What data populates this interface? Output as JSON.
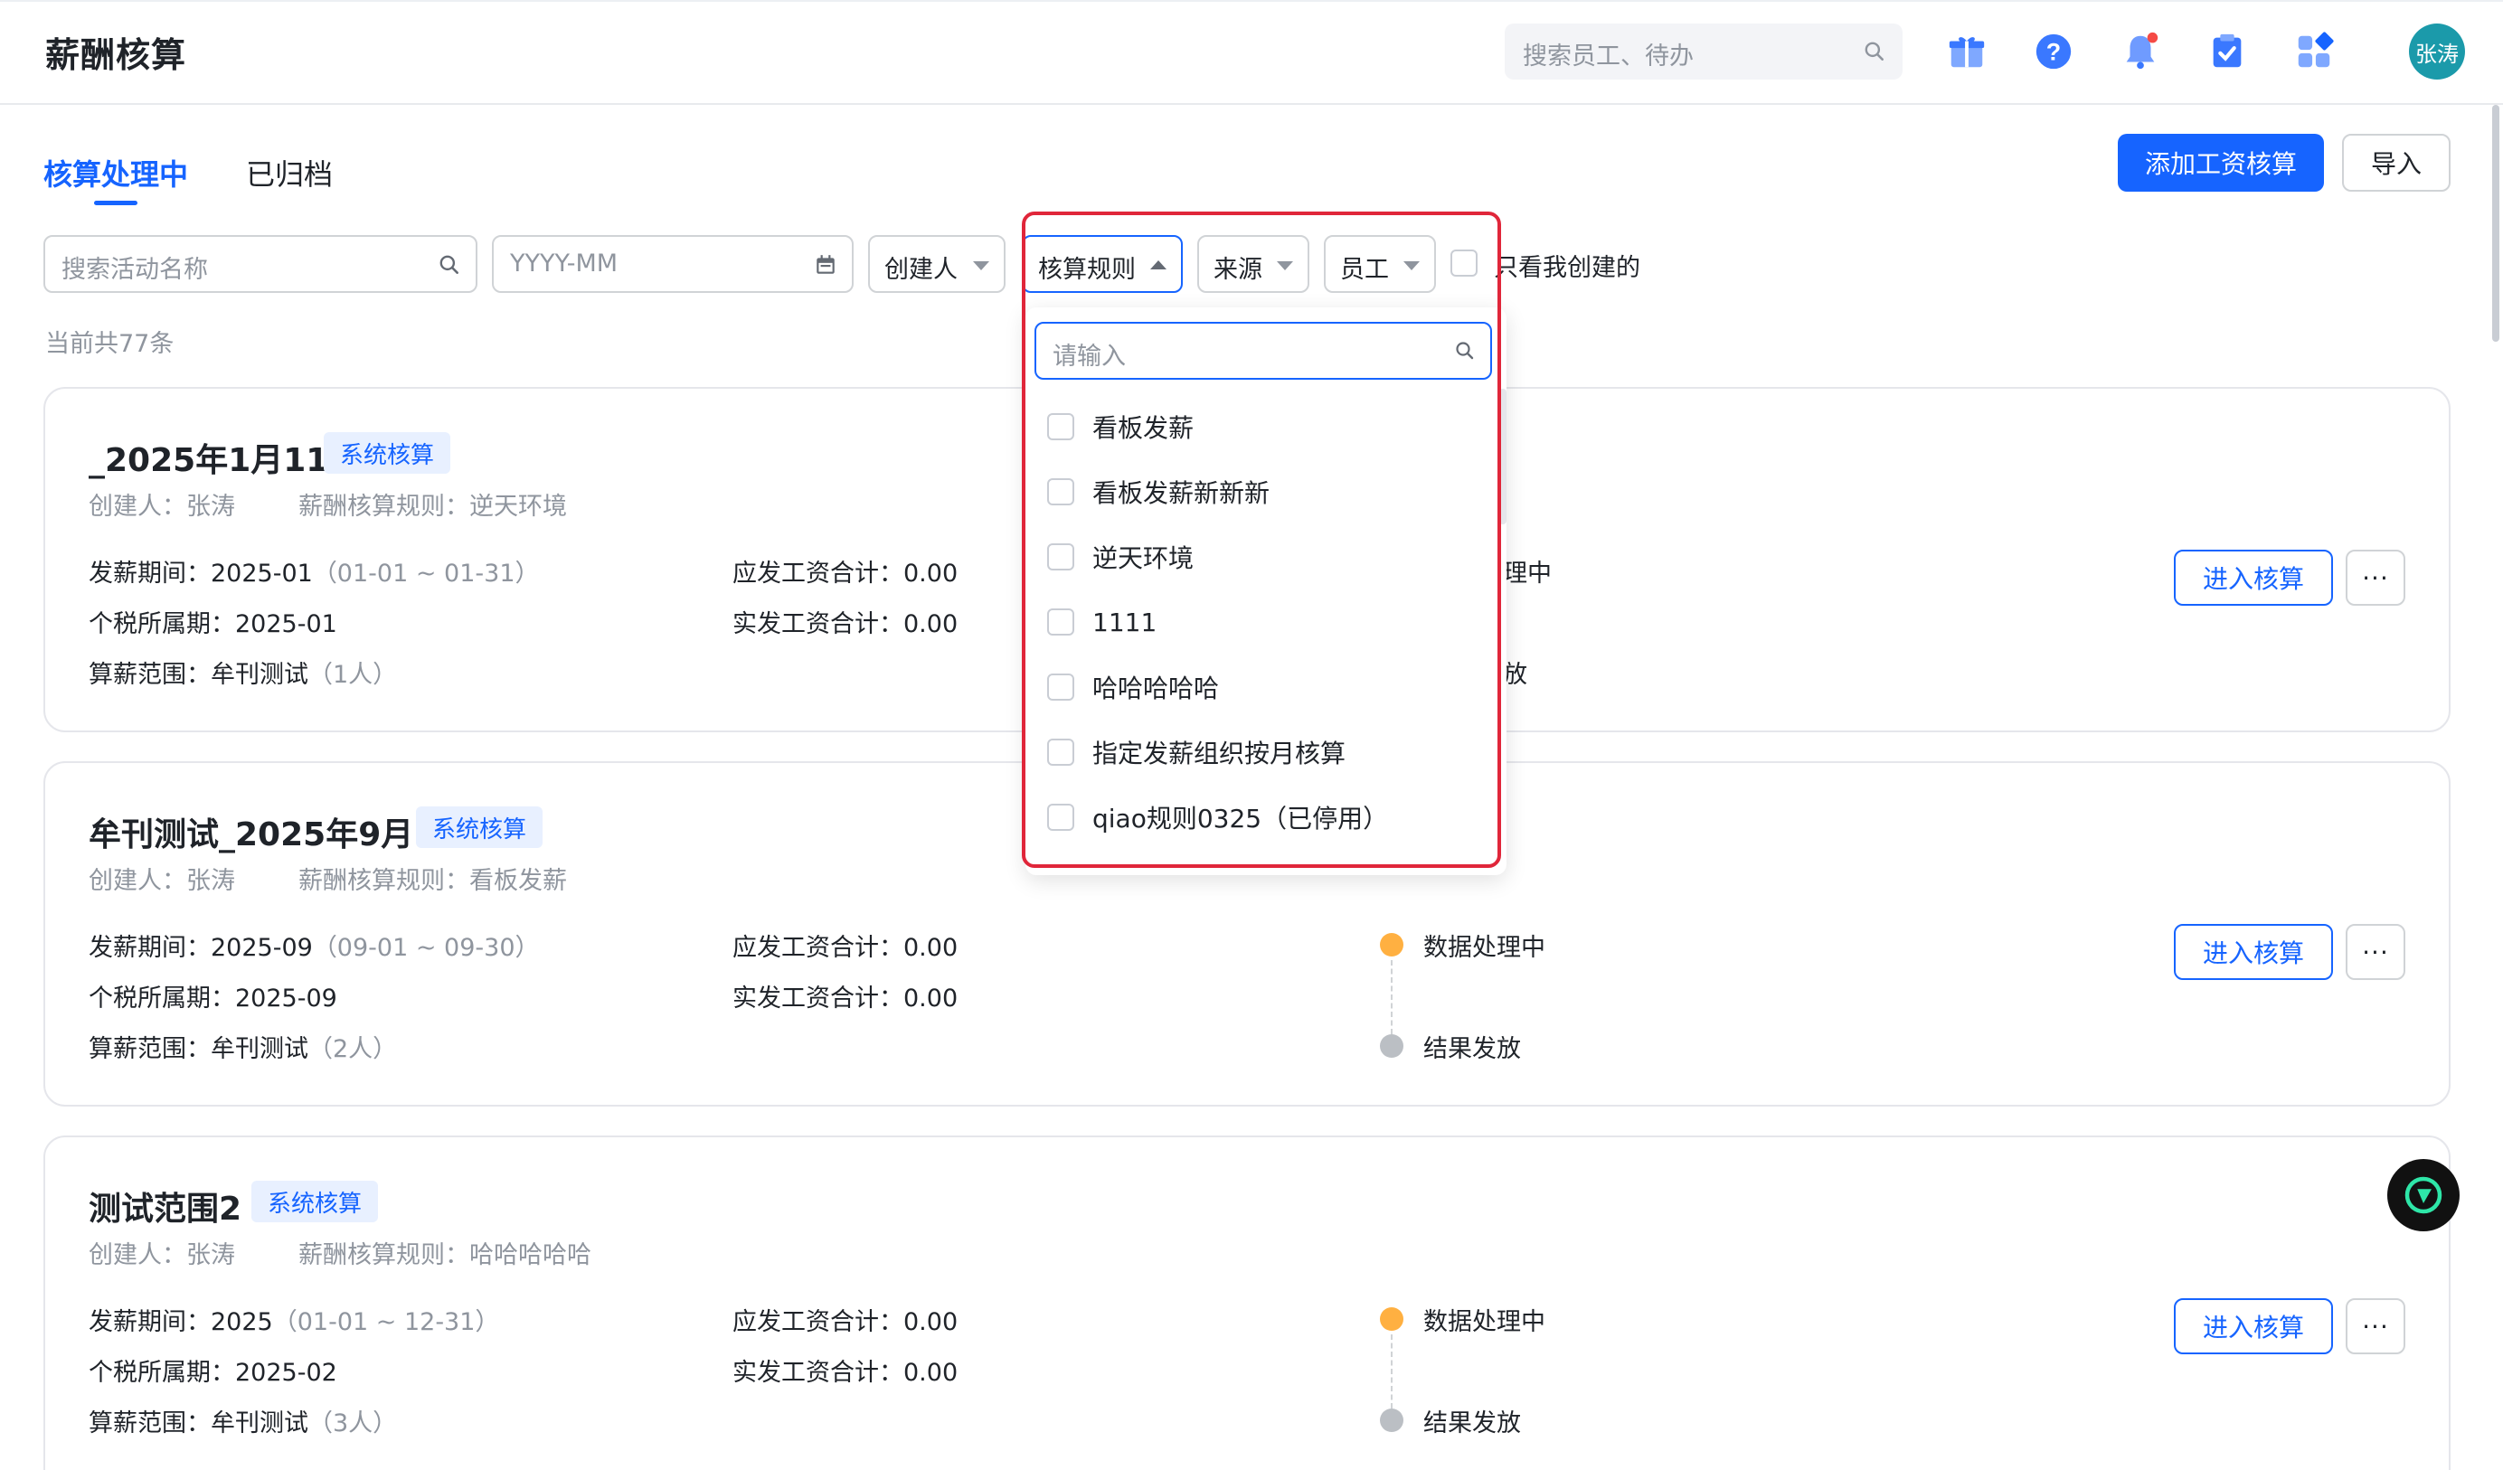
{
  "header": {
    "title": "薪酬核算",
    "search_placeholder": "搜索员工、待办",
    "avatar_text": "张涛",
    "icons": [
      "gift-icon",
      "help-icon",
      "bell-icon",
      "todo-icon",
      "apps-icon"
    ]
  },
  "tabs": [
    {
      "label": "核算处理中",
      "active": true
    },
    {
      "label": "已归档",
      "active": false
    }
  ],
  "actions": {
    "add_label": "添加工资核算",
    "import_label": "导入"
  },
  "filters": {
    "search_placeholder": "搜索活动名称",
    "month_placeholder": "YYYY-MM",
    "creator_label": "创建人",
    "rule_label": "核算规则",
    "source_label": "来源",
    "employee_label": "员工",
    "only_mine_label": "只看我创建的"
  },
  "count_text": "当前共77条",
  "dropdown": {
    "search_placeholder": "请输入",
    "items": [
      "看板发薪",
      "看板发薪新新新",
      "逆天环境",
      "1111",
      "哈哈哈哈哈",
      "指定发薪组织按月核算",
      "qiao规则0325（已停用）"
    ]
  },
  "cards": [
    {
      "title": "_2025年1月111",
      "tag": "系统核算",
      "creator": "创建人：张涛",
      "rule": "薪酬核算规则：逆天环境",
      "period_label": "发薪期间：",
      "period_value": "2025-01",
      "period_range": "（01-01 ~ 01-31）",
      "tax_label": "个税所属期：",
      "tax_value": "2025-01",
      "scope_label": "算薪范围：",
      "scope_value": "牟刊测试",
      "scope_count": "（1人）",
      "payable_label": "应发工资合计：",
      "payable_value": "0.00",
      "actual_label": "实发工资合计：",
      "actual_value": "0.00",
      "status1_partial": "理中",
      "status2_partial": "放",
      "enter_label": "进入核算",
      "more_label": "···"
    },
    {
      "title": "牟刊测试_2025年9月",
      "tag": "系统核算",
      "creator": "创建人：张涛",
      "rule": "薪酬核算规则：看板发薪",
      "period_label": "发薪期间：",
      "period_value": "2025-09",
      "period_range": "（09-01 ~ 09-30）",
      "tax_label": "个税所属期：",
      "tax_value": "2025-09",
      "scope_label": "算薪范围：",
      "scope_value": "牟刊测试",
      "scope_count": "（2人）",
      "payable_label": "应发工资合计：",
      "payable_value": "0.00",
      "actual_label": "实发工资合计：",
      "actual_value": "0.00",
      "status1": "数据处理中",
      "status2": "结果发放",
      "enter_label": "进入核算",
      "more_label": "···"
    },
    {
      "title": "测试范围2",
      "tag": "系统核算",
      "creator": "创建人：张涛",
      "rule": "薪酬核算规则：哈哈哈哈哈",
      "period_label": "发薪期间：",
      "period_value": "2025",
      "period_range": "（01-01 ~ 12-31）",
      "tax_label": "个税所属期：",
      "tax_value": "2025-02",
      "scope_label": "算薪范围：",
      "scope_value": "牟刊测试",
      "scope_count": "（3人）",
      "payable_label": "应发工资合计：",
      "payable_value": "0.00",
      "actual_label": "实发工资合计：",
      "actual_value": "0.00",
      "status1": "数据处理中",
      "status2": "结果发放",
      "enter_label": "进入核算",
      "more_label": "···"
    }
  ],
  "colors": {
    "primary": "#1664ff",
    "highlight_frame": "#e0263a",
    "status_processing": "#ffb041",
    "status_pending": "#bbbfc4"
  }
}
